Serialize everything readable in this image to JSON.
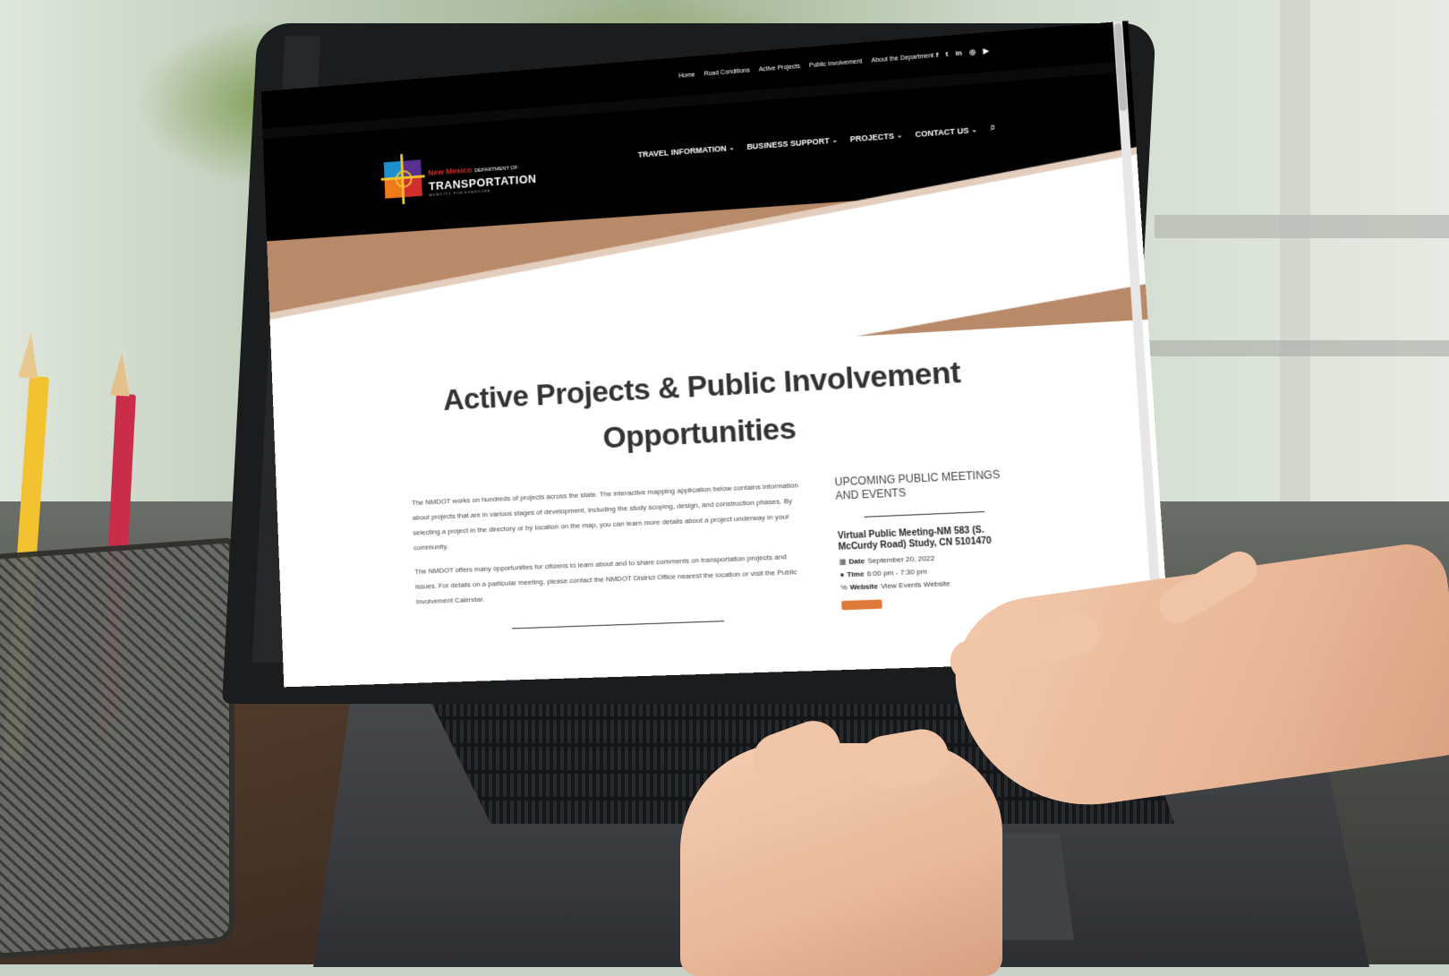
{
  "top_nav": {
    "home": "Home",
    "road_conditions": "Road Conditions",
    "active_projects": "Active Projects",
    "public_involvement": "Public Involvement",
    "about": "About the Department"
  },
  "social": {
    "facebook": "f",
    "twitter": "t",
    "linkedin": "in",
    "instagram": "◎",
    "youtube": "▶"
  },
  "logo": {
    "line1": "New Mexico",
    "line1b": "DEPARTMENT OF",
    "line2": "TRANSPORTATION",
    "tagline": "MOBILITY FOR EVERYONE"
  },
  "main_nav": {
    "travel": "TRAVEL INFORMATION",
    "business": "BUSINESS SUPPORT",
    "projects": "PROJECTS",
    "contact": "CONTACT US",
    "chevron": "⌄",
    "search_icon": "⌕"
  },
  "page": {
    "title_line1": "Active Projects & Public Involvement",
    "title_line2": "Opportunities",
    "para1": "The NMDOT works on hundreds of projects across the state.  The interactive mapping application below contains information about projects that are in various stages of development, including the study scoping, design, and construction phases.  By selecting a project in the directory or by location on the map, you can learn more details about a project underway in your community.",
    "para2": "The NMDOT offers many opportunities for citizens to learn about and to share comments on transportation projects and issues. For details on a particular meeting, please contact the NMDOT District Office nearest the location or visit the Public Involvement Calendar."
  },
  "sidebar": {
    "heading": "UPCOMING PUBLIC MEETINGS AND EVENTS",
    "event_title": "Virtual Public Meeting-NM 583 (S. McCurdy Road) Study, CN 5101470",
    "date_label": "Date",
    "date_value": "September 20, 2022",
    "time_label": "Time",
    "time_value": "6:00 pm - 7:30 pm",
    "website_label": "Website",
    "website_value": "View Events Website",
    "calendar_icon": "▦",
    "clock_icon": "●",
    "link_icon": "%"
  },
  "colors": {
    "hero": "#b98a6a",
    "accent_button": "#e07a3a",
    "header": "#000000"
  }
}
